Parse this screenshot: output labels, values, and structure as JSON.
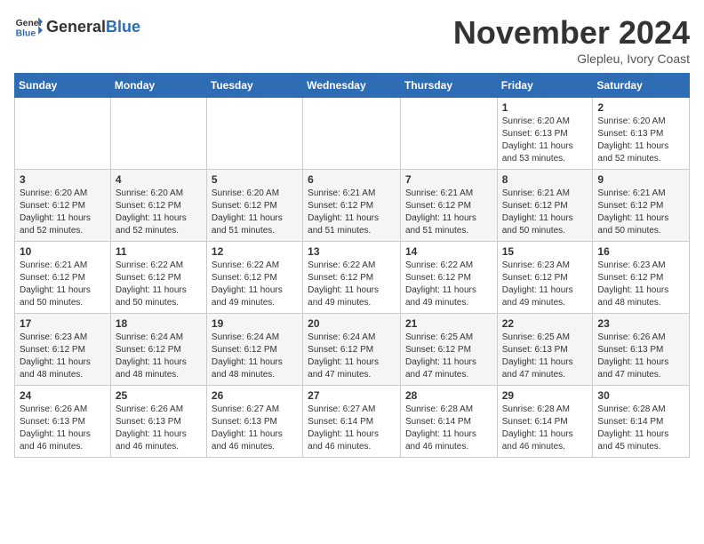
{
  "header": {
    "logo_general": "General",
    "logo_blue": "Blue",
    "month_title": "November 2024",
    "location": "Glepleu, Ivory Coast"
  },
  "days_of_week": [
    "Sunday",
    "Monday",
    "Tuesday",
    "Wednesday",
    "Thursday",
    "Friday",
    "Saturday"
  ],
  "weeks": [
    [
      {
        "day": "",
        "info": ""
      },
      {
        "day": "",
        "info": ""
      },
      {
        "day": "",
        "info": ""
      },
      {
        "day": "",
        "info": ""
      },
      {
        "day": "",
        "info": ""
      },
      {
        "day": "1",
        "info": "Sunrise: 6:20 AM\nSunset: 6:13 PM\nDaylight: 11 hours and 53 minutes."
      },
      {
        "day": "2",
        "info": "Sunrise: 6:20 AM\nSunset: 6:13 PM\nDaylight: 11 hours and 52 minutes."
      }
    ],
    [
      {
        "day": "3",
        "info": "Sunrise: 6:20 AM\nSunset: 6:12 PM\nDaylight: 11 hours and 52 minutes."
      },
      {
        "day": "4",
        "info": "Sunrise: 6:20 AM\nSunset: 6:12 PM\nDaylight: 11 hours and 52 minutes."
      },
      {
        "day": "5",
        "info": "Sunrise: 6:20 AM\nSunset: 6:12 PM\nDaylight: 11 hours and 51 minutes."
      },
      {
        "day": "6",
        "info": "Sunrise: 6:21 AM\nSunset: 6:12 PM\nDaylight: 11 hours and 51 minutes."
      },
      {
        "day": "7",
        "info": "Sunrise: 6:21 AM\nSunset: 6:12 PM\nDaylight: 11 hours and 51 minutes."
      },
      {
        "day": "8",
        "info": "Sunrise: 6:21 AM\nSunset: 6:12 PM\nDaylight: 11 hours and 50 minutes."
      },
      {
        "day": "9",
        "info": "Sunrise: 6:21 AM\nSunset: 6:12 PM\nDaylight: 11 hours and 50 minutes."
      }
    ],
    [
      {
        "day": "10",
        "info": "Sunrise: 6:21 AM\nSunset: 6:12 PM\nDaylight: 11 hours and 50 minutes."
      },
      {
        "day": "11",
        "info": "Sunrise: 6:22 AM\nSunset: 6:12 PM\nDaylight: 11 hours and 50 minutes."
      },
      {
        "day": "12",
        "info": "Sunrise: 6:22 AM\nSunset: 6:12 PM\nDaylight: 11 hours and 49 minutes."
      },
      {
        "day": "13",
        "info": "Sunrise: 6:22 AM\nSunset: 6:12 PM\nDaylight: 11 hours and 49 minutes."
      },
      {
        "day": "14",
        "info": "Sunrise: 6:22 AM\nSunset: 6:12 PM\nDaylight: 11 hours and 49 minutes."
      },
      {
        "day": "15",
        "info": "Sunrise: 6:23 AM\nSunset: 6:12 PM\nDaylight: 11 hours and 49 minutes."
      },
      {
        "day": "16",
        "info": "Sunrise: 6:23 AM\nSunset: 6:12 PM\nDaylight: 11 hours and 48 minutes."
      }
    ],
    [
      {
        "day": "17",
        "info": "Sunrise: 6:23 AM\nSunset: 6:12 PM\nDaylight: 11 hours and 48 minutes."
      },
      {
        "day": "18",
        "info": "Sunrise: 6:24 AM\nSunset: 6:12 PM\nDaylight: 11 hours and 48 minutes."
      },
      {
        "day": "19",
        "info": "Sunrise: 6:24 AM\nSunset: 6:12 PM\nDaylight: 11 hours and 48 minutes."
      },
      {
        "day": "20",
        "info": "Sunrise: 6:24 AM\nSunset: 6:12 PM\nDaylight: 11 hours and 47 minutes."
      },
      {
        "day": "21",
        "info": "Sunrise: 6:25 AM\nSunset: 6:12 PM\nDaylight: 11 hours and 47 minutes."
      },
      {
        "day": "22",
        "info": "Sunrise: 6:25 AM\nSunset: 6:13 PM\nDaylight: 11 hours and 47 minutes."
      },
      {
        "day": "23",
        "info": "Sunrise: 6:26 AM\nSunset: 6:13 PM\nDaylight: 11 hours and 47 minutes."
      }
    ],
    [
      {
        "day": "24",
        "info": "Sunrise: 6:26 AM\nSunset: 6:13 PM\nDaylight: 11 hours and 46 minutes."
      },
      {
        "day": "25",
        "info": "Sunrise: 6:26 AM\nSunset: 6:13 PM\nDaylight: 11 hours and 46 minutes."
      },
      {
        "day": "26",
        "info": "Sunrise: 6:27 AM\nSunset: 6:13 PM\nDaylight: 11 hours and 46 minutes."
      },
      {
        "day": "27",
        "info": "Sunrise: 6:27 AM\nSunset: 6:14 PM\nDaylight: 11 hours and 46 minutes."
      },
      {
        "day": "28",
        "info": "Sunrise: 6:28 AM\nSunset: 6:14 PM\nDaylight: 11 hours and 46 minutes."
      },
      {
        "day": "29",
        "info": "Sunrise: 6:28 AM\nSunset: 6:14 PM\nDaylight: 11 hours and 46 minutes."
      },
      {
        "day": "30",
        "info": "Sunrise: 6:28 AM\nSunset: 6:14 PM\nDaylight: 11 hours and 45 minutes."
      }
    ]
  ]
}
